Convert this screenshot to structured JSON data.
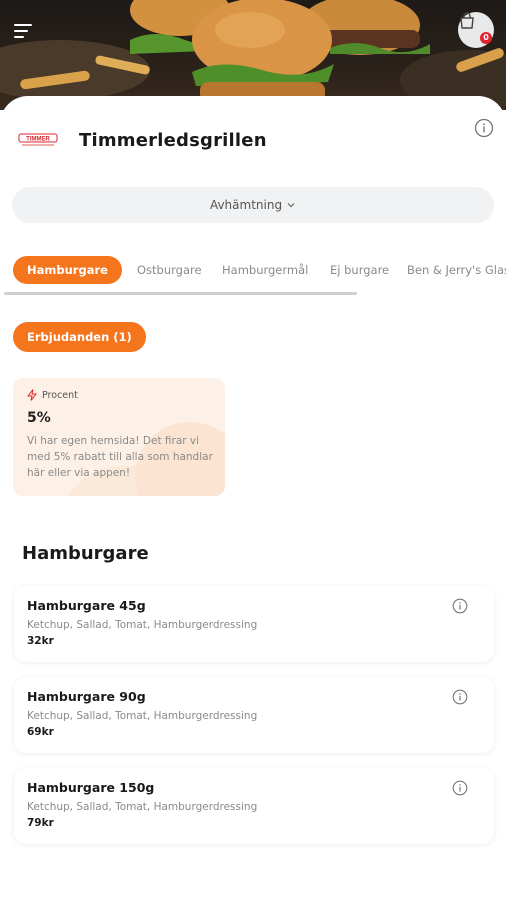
{
  "app": {
    "icons": {
      "menu": "hamburger-menu-icon",
      "cart": "shopping-bag-icon",
      "info": "info-icon",
      "chevron": "chevron-down-icon",
      "promo": "lightning-icon"
    },
    "colors": {
      "accent": "#f5751d",
      "badge": "#e0232e",
      "logo_red": "#d8262e"
    }
  },
  "header": {
    "cart_badge": "0"
  },
  "store": {
    "name": "Timmerledsgrillen",
    "logo_text": "TIMMER"
  },
  "delivery": {
    "label": "Avhämtning"
  },
  "categories": [
    {
      "label": "Hamburgare",
      "active": true
    },
    {
      "label": "Ostburgare",
      "active": false
    },
    {
      "label": "Hamburgermål",
      "active": false
    },
    {
      "label": "Ej burgare",
      "active": false
    },
    {
      "label": "Ben & Jerry's Glas",
      "active": false
    }
  ],
  "offers": {
    "pill_label": "Erbjudanden (1)",
    "card": {
      "type_label": "Procent",
      "value": "5%",
      "description": "Vi har egen hemsida! Det firar vi med 5% rabatt till alla som handlar här eller via appen!"
    }
  },
  "section": {
    "title": "Hamburgare"
  },
  "items": [
    {
      "name": "Hamburgare 45g",
      "description": "Ketchup, Sallad, Tomat, Hamburgerdressing",
      "price": "32kr"
    },
    {
      "name": "Hamburgare 90g",
      "description": "Ketchup, Sallad, Tomat, Hamburgerdressing",
      "price": "69kr"
    },
    {
      "name": "Hamburgare 150g",
      "description": "Ketchup, Sallad, Tomat, Hamburgerdressing",
      "price": "79kr"
    }
  ]
}
